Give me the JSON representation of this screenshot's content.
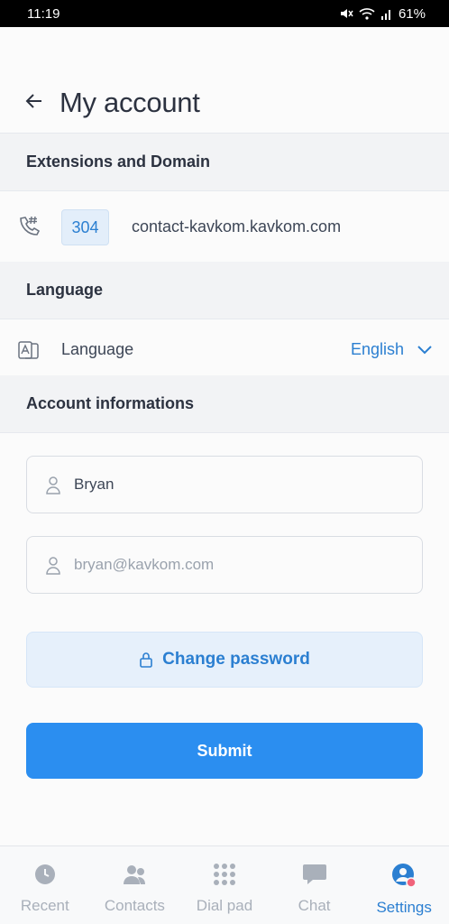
{
  "status_bar": {
    "time": "11:19",
    "battery": "61%"
  },
  "header": {
    "title": "My account"
  },
  "sections": {
    "extensions": "Extensions and Domain",
    "language": "Language",
    "account": "Account informations"
  },
  "extension": {
    "number": "304",
    "domain": "contact-kavkom.kavkom.com"
  },
  "language": {
    "label": "Language",
    "selected": "English"
  },
  "account": {
    "name_value": "Bryan",
    "email_placeholder": "bryan@kavkom.com",
    "change_password_label": "Change password",
    "submit_label": "Submit"
  },
  "bottom_nav": [
    {
      "label": "Recent",
      "icon": "clock-icon"
    },
    {
      "label": "Contacts",
      "icon": "contacts-icon"
    },
    {
      "label": "Dial pad",
      "icon": "dialpad-icon"
    },
    {
      "label": "Chat",
      "icon": "chat-icon"
    },
    {
      "label": "Settings",
      "icon": "user-settings-icon",
      "active": true
    }
  ],
  "colors": {
    "accent": "#2b7fd1",
    "submit": "#2b8ef0",
    "section_bg": "#f2f3f5",
    "inactive_nav": "#a9b0ba"
  }
}
